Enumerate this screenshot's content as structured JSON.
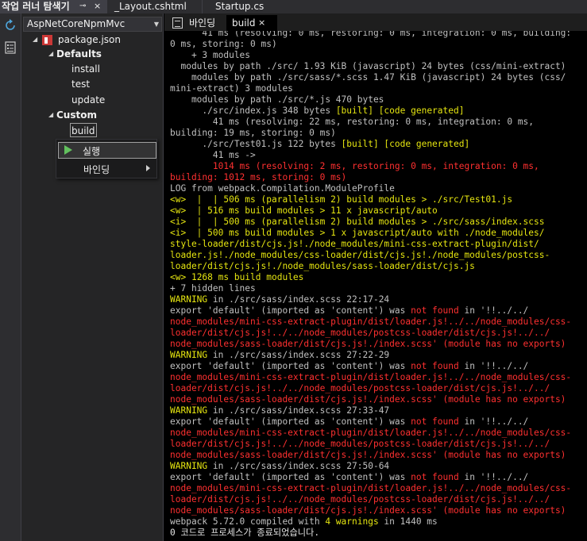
{
  "top_tabs": {
    "explorer_title": "작업 러너 탐색기",
    "explorer_pin": "⊸",
    "explorer_close": "×",
    "layout_tab": "_Layout.cshtml",
    "startup_tab": "Startup.cs"
  },
  "sidebar": {
    "project": "AspNetCoreNpmMvc",
    "tree": {
      "package": "package.json",
      "defaults": "Defaults",
      "install": "install",
      "test": "test",
      "update": "update",
      "custom": "Custom",
      "build": "build"
    }
  },
  "context_menu": {
    "run": "실행",
    "bindings": "바인딩"
  },
  "output_tabs": {
    "bindings": "바인딩",
    "build": "build",
    "close": "×"
  },
  "colors": {
    "normal": "#c0c0c0",
    "white": "#e5e5e5",
    "yellow": "#e5e510",
    "red": "#ff3030"
  },
  "output_lines": [
    [
      [
        "g",
        "      41 ms (resolving: 0 ms, restoring: 0 ms, integration: 0 ms, building:"
      ]
    ],
    [
      [
        "g",
        "0 ms, storing: 0 ms)"
      ]
    ],
    [
      [
        "g",
        "    + 3 modules"
      ]
    ],
    [
      [
        "g",
        "  modules by path ./src/ 1.93 KiB (javascript) 24 bytes (css/mini-extract)"
      ]
    ],
    [
      [
        "g",
        "    modules by path ./src/sass/*.scss 1.47 KiB (javascript) 24 bytes (css/"
      ]
    ],
    [
      [
        "g",
        "mini-extract) 3 modules"
      ]
    ],
    [
      [
        "g",
        "    modules by path ./src/*.js 470 bytes"
      ]
    ],
    [
      [
        "g",
        "      ./src/index.js 348 bytes "
      ],
      [
        "y",
        "[built] [code generated]"
      ]
    ],
    [
      [
        "g",
        "        41 ms (resolving: 22 ms, restoring: 0 ms, integration: 0 ms,"
      ]
    ],
    [
      [
        "g",
        "building: 19 ms, storing: 0 ms)"
      ]
    ],
    [
      [
        "g",
        "      ./src/Test01.js 122 bytes "
      ],
      [
        "y",
        "[built] [code generated]"
      ]
    ],
    [
      [
        "g",
        "        41 ms ->"
      ]
    ],
    [
      [
        "r",
        "        1014 ms (resolving: 2 ms, restoring: 0 ms, integration: 0 ms,"
      ]
    ],
    [
      [
        "r",
        "building: 1012 ms, storing: 0 ms)"
      ]
    ],
    [
      [
        "g",
        "LOG from webpack.Compilation.ModuleProfile"
      ]
    ],
    [
      [
        "y",
        "<w>  |  | 506 ms (parallelism 2) build modules > ./src/Test01.js"
      ]
    ],
    [
      [
        "y",
        "<w>  | 516 ms build modules > 11 x javascript/auto"
      ]
    ],
    [
      [
        "y",
        "<i>  |  | 500 ms (parallelism 2) build modules > ./src/sass/index.scss"
      ]
    ],
    [
      [
        "y",
        "<i>  | 500 ms build modules > 1 x javascript/auto with ./node_modules/"
      ]
    ],
    [
      [
        "y",
        "style-loader/dist/cjs.js!./node_modules/mini-css-extract-plugin/dist/"
      ]
    ],
    [
      [
        "y",
        "loader.js!./node_modules/css-loader/dist/cjs.js!./node_modules/postcss-"
      ]
    ],
    [
      [
        "y",
        "loader/dist/cjs.js!./node_modules/sass-loader/dist/cjs.js"
      ]
    ],
    [
      [
        "y",
        "<w> "
      ],
      [
        "y",
        "1268 ms build modules"
      ]
    ],
    [
      [
        "g",
        "+ 7 hidden lines"
      ]
    ],
    [
      [
        "y",
        "WARNING"
      ],
      [
        "g",
        " in ./src/sass/index.scss 22:17-24"
      ]
    ],
    [
      [
        "g",
        "export 'default' (imported as 'content') was "
      ],
      [
        "r",
        "not found"
      ],
      [
        "g",
        " in '!!../../"
      ]
    ],
    [
      [
        "r",
        "node_modules/mini-css-extract-plugin/dist/loader.js!../../node_modules/css-"
      ]
    ],
    [
      [
        "r",
        "loader/dist/cjs.js!../../node_modules/postcss-loader/dist/cjs.js!../../"
      ]
    ],
    [
      [
        "r",
        "node_modules/sass-loader/dist/cjs.js!./index.scss' (module has no exports)"
      ]
    ],
    [
      [
        "y",
        "WARNING"
      ],
      [
        "g",
        " in ./src/sass/index.scss 27:22-29"
      ]
    ],
    [
      [
        "g",
        "export 'default' (imported as 'content') was "
      ],
      [
        "r",
        "not found"
      ],
      [
        "g",
        " in '!!../../"
      ]
    ],
    [
      [
        "r",
        "node_modules/mini-css-extract-plugin/dist/loader.js!../../node_modules/css-"
      ]
    ],
    [
      [
        "r",
        "loader/dist/cjs.js!../../node_modules/postcss-loader/dist/cjs.js!../../"
      ]
    ],
    [
      [
        "r",
        "node_modules/sass-loader/dist/cjs.js!./index.scss' (module has no exports)"
      ]
    ],
    [
      [
        "y",
        "WARNING"
      ],
      [
        "g",
        " in ./src/sass/index.scss 27:33-47"
      ]
    ],
    [
      [
        "g",
        "export 'default' (imported as 'content') was "
      ],
      [
        "r",
        "not found"
      ],
      [
        "g",
        " in '!!../../"
      ]
    ],
    [
      [
        "r",
        "node_modules/mini-css-extract-plugin/dist/loader.js!../../node_modules/css-"
      ]
    ],
    [
      [
        "r",
        "loader/dist/cjs.js!../../node_modules/postcss-loader/dist/cjs.js!../../"
      ]
    ],
    [
      [
        "r",
        "node_modules/sass-loader/dist/cjs.js!./index.scss' (module has no exports)"
      ]
    ],
    [
      [
        "y",
        "WARNING"
      ],
      [
        "g",
        " in ./src/sass/index.scss 27:50-64"
      ]
    ],
    [
      [
        "g",
        "export 'default' (imported as 'content') was "
      ],
      [
        "r",
        "not found"
      ],
      [
        "g",
        " in '!!../../"
      ]
    ],
    [
      [
        "r",
        "node_modules/mini-css-extract-plugin/dist/loader.js!../../node_modules/css-"
      ]
    ],
    [
      [
        "r",
        "loader/dist/cjs.js!../../node_modules/postcss-loader/dist/cjs.js!../../"
      ]
    ],
    [
      [
        "r",
        "node_modules/sass-loader/dist/cjs.js!./index.scss' (module has no exports)"
      ]
    ],
    [
      [
        "g",
        "webpack 5.72.0 compiled with "
      ],
      [
        "y",
        "4 warnings"
      ],
      [
        "g",
        " in 1440 ms"
      ]
    ],
    [
      [
        "w",
        "0 코드로 프로세스가 종료되었습니다."
      ]
    ]
  ]
}
